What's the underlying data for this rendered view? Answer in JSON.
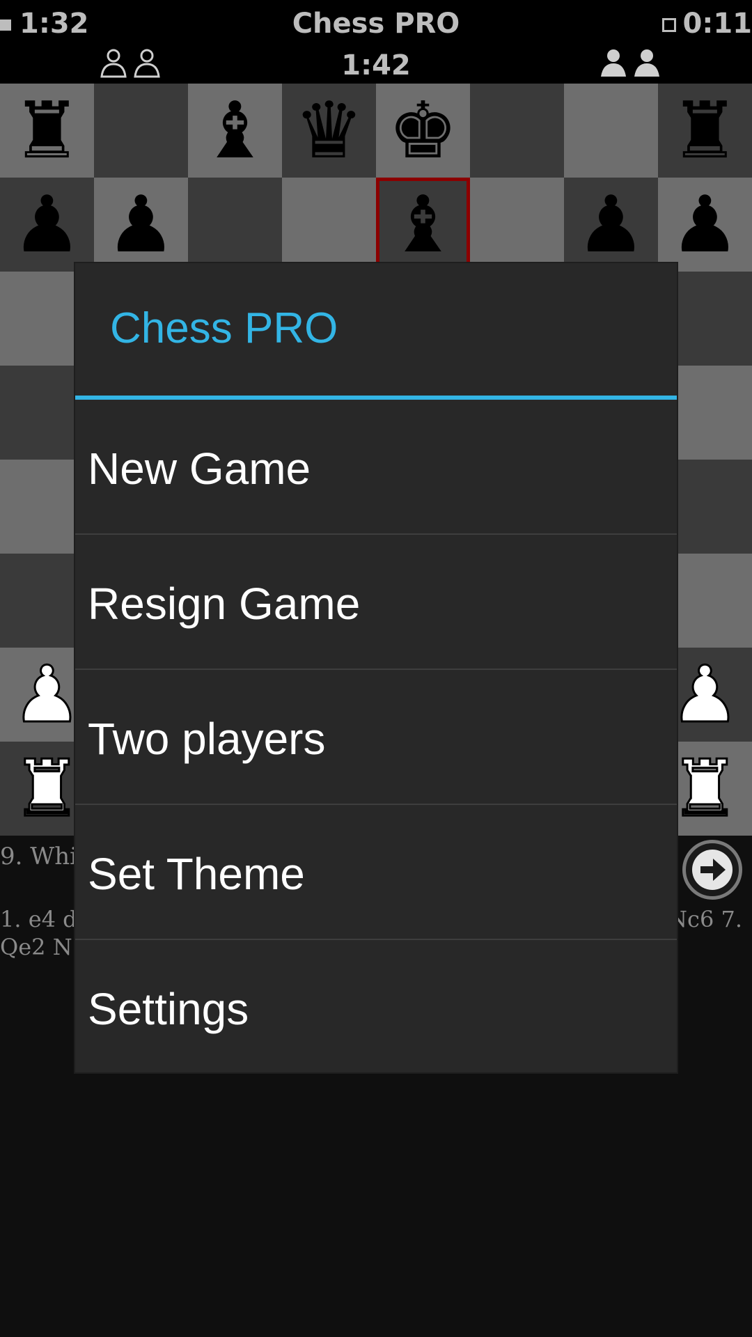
{
  "header": {
    "clock_left": "1:32",
    "title": "Chess PRO",
    "clock_right": "0:11",
    "move_timer": "1:42"
  },
  "colors": {
    "accent": "#33b5e5",
    "board_light": "#6e6e6e",
    "board_dark": "#3a3a3a",
    "highlight": "#8b0000"
  },
  "board": {
    "rows": [
      [
        "r",
        "",
        "b",
        "q",
        "k",
        "",
        "",
        "r"
      ],
      [
        "p",
        "p",
        "",
        "",
        "b",
        "",
        "p",
        "p"
      ],
      [
        "",
        "",
        "",
        "",
        "",
        "",
        "",
        ""
      ],
      [
        "",
        "",
        "",
        "",
        "",
        "",
        "",
        ""
      ],
      [
        "",
        "",
        "",
        "",
        "",
        "",
        "",
        ""
      ],
      [
        "",
        "",
        "",
        "",
        "",
        "",
        "",
        ""
      ],
      [
        "P",
        "",
        "",
        "",
        "",
        "",
        "",
        "P"
      ],
      [
        "R",
        "",
        "",
        "",
        "",
        "",
        "",
        "R"
      ]
    ],
    "highlighted_square": "e7"
  },
  "moves": {
    "status_line": "9. Whi",
    "status_line_right": "",
    "move_list_line1_left": "1. e4 d",
    "move_list_line1_right": "Nc6 7.",
    "move_list_line2_left": "Qe2 N",
    "next_icon": "arrow-right-icon"
  },
  "dialog": {
    "title": "Chess PRO",
    "items": [
      {
        "label": "New Game"
      },
      {
        "label": "Resign Game"
      },
      {
        "label": "Two players"
      },
      {
        "label": "Set Theme"
      },
      {
        "label": "Settings"
      }
    ]
  }
}
